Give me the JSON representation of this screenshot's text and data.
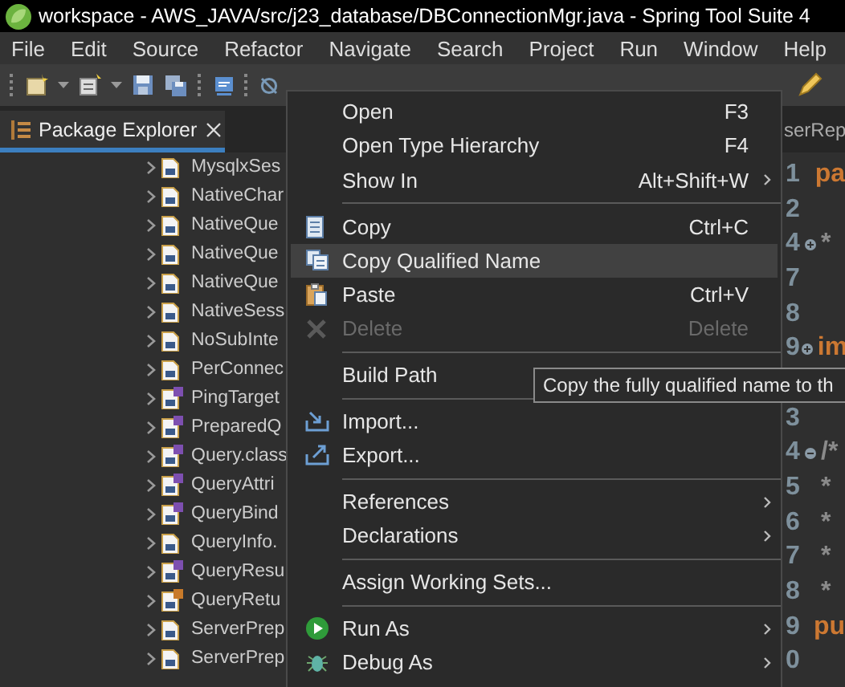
{
  "window": {
    "title": "workspace - AWS_JAVA/src/j23_database/DBConnectionMgr.java - Spring Tool Suite 4"
  },
  "menu_bar": [
    "File",
    "Edit",
    "Source",
    "Refactor",
    "Navigate",
    "Search",
    "Project",
    "Run",
    "Window",
    "Help"
  ],
  "package_explorer": {
    "tab": {
      "label": "Package Explorer",
      "selected": true
    },
    "rows": [
      {
        "label": "MysqlxSes",
        "kind": "class",
        "expanded": false
      },
      {
        "label": "NativeChar",
        "kind": "class",
        "expanded": false
      },
      {
        "label": "NativeQue",
        "kind": "class",
        "expanded": false
      },
      {
        "label": "NativeQue",
        "kind": "class",
        "expanded": false
      },
      {
        "label": "NativeQue",
        "kind": "class",
        "expanded": false
      },
      {
        "label": "NativeSess",
        "kind": "class",
        "expanded": false
      },
      {
        "label": "NoSubInte",
        "kind": "class",
        "expanded": false
      },
      {
        "label": "PerConnec",
        "kind": "class",
        "expanded": false
      },
      {
        "label": "PingTarget",
        "kind": "interface",
        "expanded": false
      },
      {
        "label": "PreparedQ",
        "kind": "interface",
        "expanded": false
      },
      {
        "label": "Query.class",
        "kind": "interface",
        "expanded": false
      },
      {
        "label": "QueryAttri",
        "kind": "interface",
        "expanded": false
      },
      {
        "label": "QueryBind",
        "kind": "interface",
        "expanded": false
      },
      {
        "label": "QueryInfo.",
        "kind": "class",
        "expanded": false
      },
      {
        "label": "QueryResu",
        "kind": "interface",
        "expanded": false
      },
      {
        "label": "QueryRetu",
        "kind": "enum",
        "expanded": false
      },
      {
        "label": "ServerPrep",
        "kind": "class",
        "expanded": false
      },
      {
        "label": "ServerPrep",
        "kind": "class",
        "expanded": false
      }
    ]
  },
  "editor": {
    "tab": "serRep",
    "line_groups": [
      [
        {
          "number": "1",
          "code": "pa",
          "kind": "keyword"
        },
        {
          "number": "2"
        },
        {
          "number": "4",
          "fold_expanded": false,
          "code": "*",
          "kind": "comment"
        },
        {
          "number": "7"
        },
        {
          "number": "8"
        },
        {
          "number": "9",
          "fold_expanded": false,
          "code": "im",
          "kind": "keyword"
        }
      ],
      [
        {
          "number": "3"
        },
        {
          "number": "4",
          "fold_expanded": true,
          "code": "/*",
          "kind": "comment"
        },
        {
          "number": "5",
          "code": "*",
          "kind": "comment"
        },
        {
          "number": "6",
          "code": "*",
          "kind": "comment"
        },
        {
          "number": "7",
          "code": "*",
          "kind": "comment"
        },
        {
          "number": "8",
          "code": "*",
          "kind": "comment"
        },
        {
          "number": "9",
          "code": "pu",
          "kind": "keyword"
        },
        {
          "number": "0"
        }
      ]
    ]
  },
  "context_menu": [
    {
      "kind": "item",
      "label": "Open",
      "shortcut": "F3",
      "submenu": false,
      "selected": false,
      "disabled": false
    },
    {
      "kind": "item",
      "label": "Open Type Hierarchy",
      "shortcut": "F4",
      "submenu": false,
      "selected": false,
      "disabled": false
    },
    {
      "kind": "item",
      "label": "Show In",
      "shortcut": "Alt+Shift+W",
      "submenu": true,
      "selected": false,
      "disabled": false
    },
    {
      "kind": "separator"
    },
    {
      "kind": "item",
      "label": "Copy",
      "shortcut": "Ctrl+C",
      "submenu": false,
      "selected": false,
      "disabled": false
    },
    {
      "kind": "item",
      "label": "Copy Qualified Name",
      "submenu": false,
      "selected": true,
      "disabled": false
    },
    {
      "kind": "item",
      "label": "Paste",
      "shortcut": "Ctrl+V",
      "submenu": false,
      "selected": false,
      "disabled": false
    },
    {
      "kind": "item",
      "label": "Delete",
      "shortcut": "Delete",
      "submenu": false,
      "selected": false,
      "disabled": true
    },
    {
      "kind": "separator"
    },
    {
      "kind": "item",
      "label": "Build Path",
      "submenu": false,
      "selected": false,
      "disabled": false
    },
    {
      "kind": "separator"
    },
    {
      "kind": "item",
      "label": "Import...",
      "submenu": false,
      "selected": false,
      "disabled": false
    },
    {
      "kind": "item",
      "label": "Export...",
      "submenu": false,
      "selected": false,
      "disabled": false
    },
    {
      "kind": "separator"
    },
    {
      "kind": "item",
      "label": "References",
      "submenu": true,
      "selected": false,
      "disabled": false
    },
    {
      "kind": "item",
      "label": "Declarations",
      "submenu": true,
      "selected": false,
      "disabled": false
    },
    {
      "kind": "separator"
    },
    {
      "kind": "item",
      "label": "Assign Working Sets...",
      "submenu": false,
      "selected": false,
      "disabled": false
    },
    {
      "kind": "separator"
    },
    {
      "kind": "item",
      "label": "Run As",
      "submenu": true,
      "selected": false,
      "disabled": false
    },
    {
      "kind": "item",
      "label": "Debug As",
      "submenu": true,
      "selected": false,
      "disabled": false
    }
  ],
  "tooltip": "Copy the fully qualified name to th"
}
